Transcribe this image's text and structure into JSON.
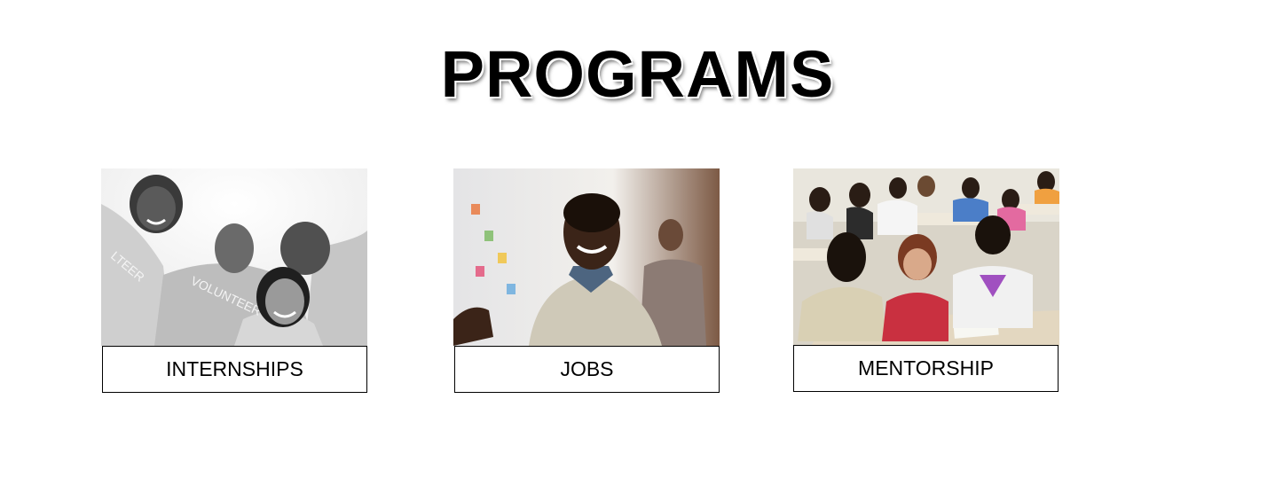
{
  "page": {
    "title": "PROGRAMS"
  },
  "programs": [
    {
      "label": "INTERNSHIPS",
      "image": "volunteers-group-photo-grayscale"
    },
    {
      "label": "JOBS",
      "image": "smiling-man-office-photo"
    },
    {
      "label": "MENTORSHIP",
      "image": "mentorship-workshop-classroom-photo"
    }
  ],
  "colors": {
    "background": "#ffffff",
    "text": "#000000",
    "border": "#000000"
  }
}
